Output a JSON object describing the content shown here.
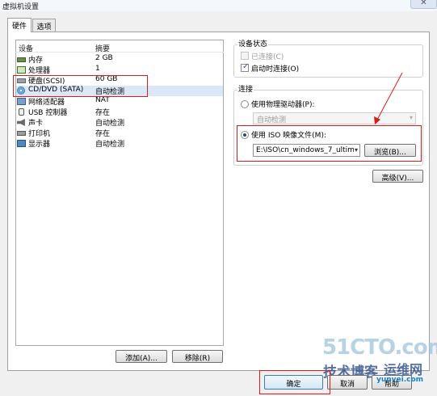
{
  "window": {
    "title": "虚拟机设置",
    "close_glyph": "✕"
  },
  "tabs": [
    {
      "label": "硬件",
      "selected": true
    },
    {
      "label": "选项",
      "selected": false
    }
  ],
  "device_table": {
    "columns": [
      "设备",
      "摘要"
    ],
    "rows": [
      {
        "icon": "memory-icon",
        "name": "内存",
        "summary": "2 GB"
      },
      {
        "icon": "processor-icon",
        "name": "处理器",
        "summary": "1"
      },
      {
        "icon": "hard-disk-icon",
        "name": "硬盘(SCSI)",
        "summary": "60 GB"
      },
      {
        "icon": "cd-dvd-icon",
        "name": "CD/DVD (SATA)",
        "summary": "自动检测",
        "selected": true
      },
      {
        "icon": "network-adapter-icon",
        "name": "网络适配器",
        "summary": "NAT"
      },
      {
        "icon": "usb-icon",
        "name": "USB 控制器",
        "summary": "存在"
      },
      {
        "icon": "sound-icon",
        "name": "声卡",
        "summary": "自动检测"
      },
      {
        "icon": "printer-icon",
        "name": "打印机",
        "summary": "存在"
      },
      {
        "icon": "monitor-icon",
        "name": "显示器",
        "summary": "自动检测"
      }
    ]
  },
  "list_buttons": {
    "add": "添加(A)...",
    "remove": "移除(R)"
  },
  "device_status": {
    "title": "设备状态",
    "connected": {
      "label": "已连接(C)",
      "checked": false,
      "disabled": true
    },
    "connect_at_power_on": {
      "label": "启动时连接(O)",
      "checked": true
    }
  },
  "connection": {
    "title": "连接",
    "physical": {
      "label": "使用物理驱动器(P):",
      "selected": false,
      "drive_value": "自动检测",
      "drive_arrow": "▾"
    },
    "iso": {
      "label": "使用 ISO 映像文件(M):",
      "selected": true,
      "path": "E:\\ISO\\cn_windows_7_ultim",
      "arrow": "▾"
    },
    "browse": "浏览(B)..."
  },
  "advanced": "高级(V)...",
  "dialog_buttons": {
    "ok": "确定",
    "cancel": "取消",
    "help": "帮助"
  },
  "check_mark": "✓",
  "watermark": {
    "brand": "51CTO.com",
    "line1": "技术博客",
    "line2": "运维网",
    "url": "yunvei.com"
  },
  "annotation_color": "#d81c1c"
}
